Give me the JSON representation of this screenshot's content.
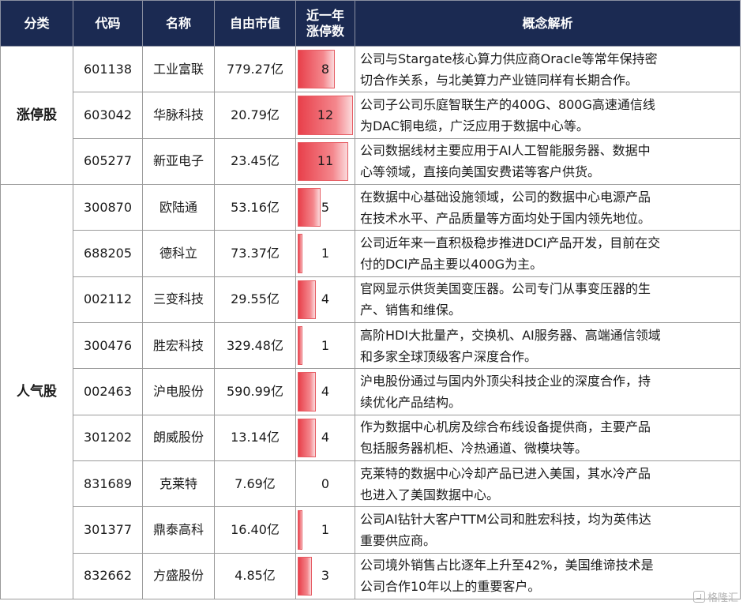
{
  "headers": {
    "category": "分类",
    "code": "代码",
    "name": "名称",
    "float_cap": "自由市值",
    "limit_up_line1": "近一年",
    "limit_up_line2": "涨停数",
    "concept": "概念解析"
  },
  "groups": [
    {
      "label": "涨停股",
      "style": "limit",
      "rows": [
        {
          "code": "601138",
          "name": "工业富联",
          "cap": "779.27亿",
          "limit_up": 8,
          "line1": "公司与Stargate核心算力供应商Oracle等常年保持密",
          "line2": "切合作关系，与北美算力产业链同样有长期合作。"
        },
        {
          "code": "603042",
          "name": "华脉科技",
          "cap": "20.79亿",
          "limit_up": 12,
          "line1": "公司子公司乐庭智联生产的400G、800G高速通信线",
          "line2": "为DAC铜电缆，广泛应用于数据中心等。"
        },
        {
          "code": "605277",
          "name": "新亚电子",
          "cap": "23.45亿",
          "limit_up": 11,
          "line1": "公司数据线材主要应用于AI人工智能服务器、数据中",
          "line2": "心等领域，直接向美国安费诺等客户供货。"
        }
      ]
    },
    {
      "label": "人气股",
      "style": "hot",
      "rows": [
        {
          "code": "300870",
          "name": "欧陆通",
          "cap": "53.16亿",
          "limit_up": 5,
          "color": "hot",
          "line1": "在数据中心基础设施领域，公司的数据中心电源产品",
          "line2": "在技术水平、产品质量等方面均处于国内领先地位。"
        },
        {
          "code": "688205",
          "name": "德科立",
          "cap": "73.37亿",
          "limit_up": 1,
          "color": "hot",
          "line1": "公司近年来一直积极稳步推进DCI产品开发，目前在交",
          "line2": "付的DCI产品主要以400G为主。"
        },
        {
          "code": "002112",
          "name": "三变科技",
          "cap": "29.55亿",
          "limit_up": 4,
          "color": "normal",
          "line1": "官网显示供货美国变压器。公司专门从事变压器的生",
          "line2": "产、销售和维保。"
        },
        {
          "code": "300476",
          "name": "胜宏科技",
          "cap": "329.48亿",
          "limit_up": 1,
          "color": "normal",
          "line1": "高阶HDI大批量产，交换机、AI服务器、高端通信领域",
          "line2": "和多家全球顶级客户深度合作。"
        },
        {
          "code": "002463",
          "name": "沪电股份",
          "cap": "590.99亿",
          "limit_up": 4,
          "color": "normal",
          "line1": "沪电股份通过与国内外顶尖科技企业的深度合作，持",
          "line2": "续优化产品结构。"
        },
        {
          "code": "301202",
          "name": "朗威股份",
          "cap": "13.14亿",
          "limit_up": 4,
          "color": "normal",
          "line1": "作为数据中心机房及综合布线设备提供商，主要产品",
          "line2": "包括服务器机柜、冷热通道、微模块等。"
        },
        {
          "code": "831689",
          "name": "克莱特",
          "cap": "7.69亿",
          "limit_up": 0,
          "color": "normal",
          "line1": "克莱特的数据中心冷却产品已进入美国，其水冷产品",
          "line2": "也进入了美国数据中心。"
        },
        {
          "code": "301377",
          "name": "鼎泰高科",
          "cap": "16.40亿",
          "limit_up": 1,
          "color": "normal",
          "line1": "公司AI钻针大客户TTM公司和胜宏科技，均为英伟达",
          "line2": "重要供应商。"
        },
        {
          "code": "832662",
          "name": "方盛股份",
          "cap": "4.85亿",
          "limit_up": 3,
          "color": "normal",
          "line1": "公司境外销售占比逐年上升至42%，美国维谛技术是",
          "line2": "公司合作10年以上的重要客户。"
        }
      ]
    }
  ],
  "bar_scale_max": 12,
  "colors": {
    "header_bg": "#1b2a52",
    "limit": "#e01f26",
    "hot": "#e0812e",
    "bar": "#e8404b"
  },
  "watermark": "格隆汇"
}
